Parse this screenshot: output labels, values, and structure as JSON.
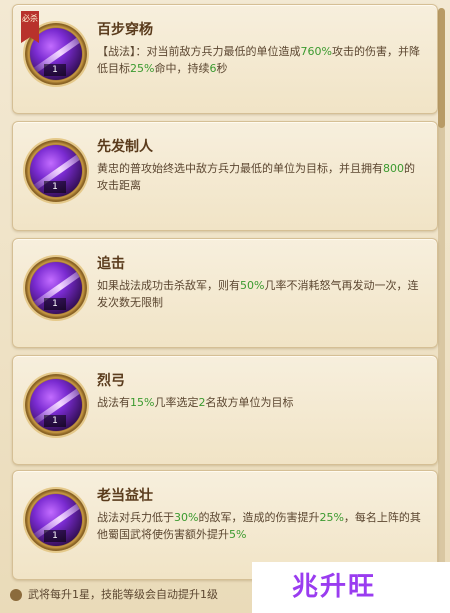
{
  "skills": [
    {
      "name": "百步穿杨",
      "badge": "必杀",
      "level": "1",
      "desc_parts": [
        {
          "t": "【战法】：对当前敌方兵力最低的单位造成",
          "hl": false
        },
        {
          "t": "760%",
          "hl": true
        },
        {
          "t": "攻击的伤害，并降低目标",
          "hl": false
        },
        {
          "t": "25%",
          "hl": true
        },
        {
          "t": "命中，持续",
          "hl": false
        },
        {
          "t": "6",
          "hl": true
        },
        {
          "t": "秒",
          "hl": false
        }
      ]
    },
    {
      "name": "先发制人",
      "level": "1",
      "desc_parts": [
        {
          "t": "黄忠的普攻始终选中敌方兵力最低的单位为目标，并且拥有",
          "hl": false
        },
        {
          "t": "800",
          "hl": true
        },
        {
          "t": "的攻击距离",
          "hl": false
        }
      ]
    },
    {
      "name": "追击",
      "level": "1",
      "desc_parts": [
        {
          "t": "如果战法成功击杀敌军，则有",
          "hl": false
        },
        {
          "t": "50%",
          "hl": true
        },
        {
          "t": "几率不消耗怒气再发动一次，连发次数无限制",
          "hl": false
        }
      ]
    },
    {
      "name": "烈弓",
      "level": "1",
      "desc_parts": [
        {
          "t": "战法有",
          "hl": false
        },
        {
          "t": "15%",
          "hl": true
        },
        {
          "t": "几率选定",
          "hl": false
        },
        {
          "t": "2",
          "hl": true
        },
        {
          "t": "名敌方单位为目标",
          "hl": false
        }
      ]
    },
    {
      "name": "老当益壮",
      "level": "1",
      "desc_parts": [
        {
          "t": "战法对兵力低于",
          "hl": false
        },
        {
          "t": "30%",
          "hl": true
        },
        {
          "t": "的敌军，造成的伤害提升",
          "hl": false
        },
        {
          "t": "25%",
          "hl": true
        },
        {
          "t": "，每名上阵的其他蜀国武将使伤害额外提升",
          "hl": false
        },
        {
          "t": "5%",
          "hl": true
        }
      ]
    }
  ],
  "footer": {
    "text": "武将每升1星，技能等级会自动提升1级"
  },
  "watermark": {
    "text": "兆升旺"
  },
  "colors": {
    "highlight": "#3b9a2f",
    "title": "#5a3b1c",
    "card_bg": "#f4e8cf"
  }
}
